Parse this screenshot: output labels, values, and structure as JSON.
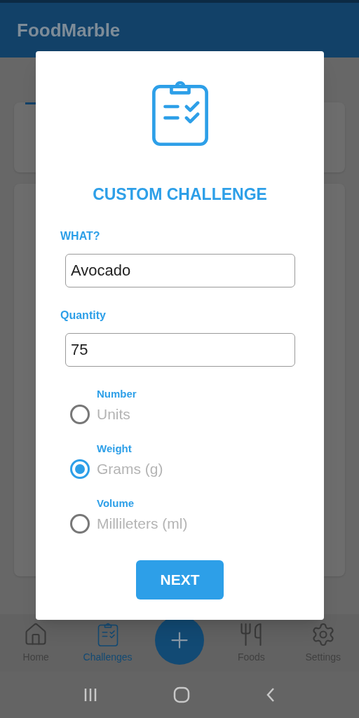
{
  "app_bar": {
    "title": "FoodMarble"
  },
  "dialog": {
    "title": "CUSTOM CHALLENGE",
    "fields": [
      {
        "label": "WHAT?",
        "value": "Avocado"
      },
      {
        "label": "Quantity",
        "value": "75"
      }
    ],
    "units": [
      {
        "group": "Number",
        "label": "Units",
        "selected": false
      },
      {
        "group": "Weight",
        "label": "Grams (g)",
        "selected": true
      },
      {
        "group": "Volume",
        "label": "Millileters (ml)",
        "selected": false
      }
    ],
    "button": "NEXT"
  },
  "bottom_nav": [
    {
      "kind": "home",
      "label": "Home",
      "selected": false
    },
    {
      "kind": "challenges",
      "label": "Challenges",
      "selected": true
    },
    {
      "kind": "add"
    },
    {
      "kind": "foods",
      "label": "Foods",
      "selected": false
    },
    {
      "kind": "settings",
      "label": "Settings",
      "selected": false
    }
  ]
}
